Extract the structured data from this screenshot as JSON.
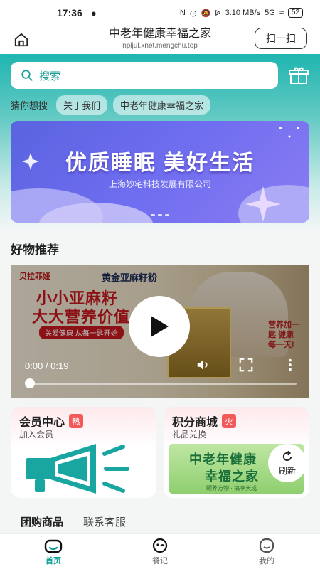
{
  "status_bar": {
    "time": "17:36",
    "network": "3.10 MB/s",
    "signal": "5G",
    "battery": "52"
  },
  "title_bar": {
    "title": "中老年健康幸福之家",
    "url": "npljul.xnet.mengchu.top",
    "scan_label": "扫一扫"
  },
  "search": {
    "placeholder": "搜索"
  },
  "tags": {
    "label": "猜你想搜",
    "items": [
      "关于我们",
      "中老年健康幸福之家"
    ]
  },
  "banner": {
    "title": "优质睡眠 美好生活",
    "subtitle": "上海妙宅科技发展有限公司"
  },
  "section": {
    "title": "好物推荐"
  },
  "video": {
    "brand": "贝拉菲娅",
    "product": "黄金亚麻籽粉",
    "line1": "小小亚麻籽",
    "line2": "大大营养价值",
    "ribbon": "关爱健康 从每一匙开始",
    "slogan": "营养加一匙 健康每一天!",
    "time": "0:00 / 0:19",
    "progress": 0
  },
  "cards": {
    "member": {
      "title": "会员中心",
      "badge": "热",
      "subtitle": "加入会员"
    },
    "points": {
      "title": "积分商城",
      "badge": "火",
      "subtitle": "礼品兑换",
      "promo_line1": "中老年健康",
      "promo_line2": "幸福之家",
      "promo_line3": "颐养万物 · 搞享天成",
      "refresh_label": "刷新"
    }
  },
  "bottom_tabs": [
    "团购商品",
    "联系客服"
  ],
  "nav": [
    {
      "label": "首页",
      "icon": "home-icon",
      "active": true
    },
    {
      "label": "餐记",
      "icon": "meal-icon",
      "active": false
    },
    {
      "label": "我的",
      "icon": "profile-icon",
      "active": false
    }
  ],
  "colors": {
    "accent": "#1fb5b0",
    "nav_active": "#0f9f98",
    "badge": "#f25a5a",
    "banner": "#6f6ef0"
  }
}
